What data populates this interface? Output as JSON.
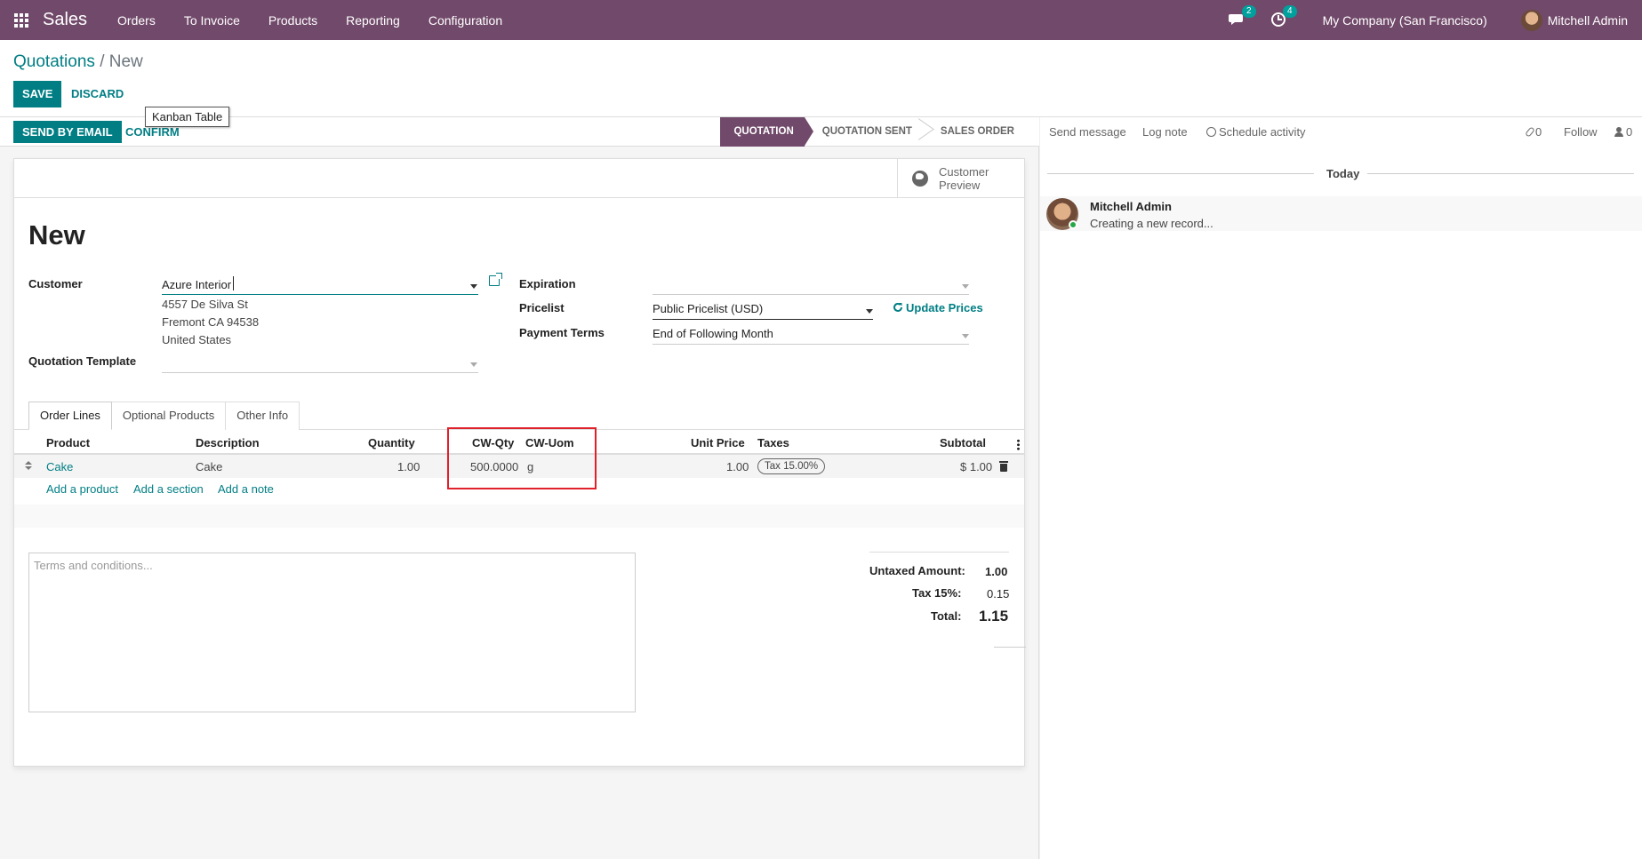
{
  "navbar": {
    "app_name": "Sales",
    "menu": [
      "Orders",
      "To Invoice",
      "Products",
      "Reporting",
      "Configuration"
    ],
    "messages_badge": "2",
    "activities_badge": "4",
    "company": "My Company (San Francisco)",
    "user": "Mitchell Admin"
  },
  "breadcrumb": {
    "parent": "Quotations",
    "separator": "/",
    "current": "New"
  },
  "control": {
    "save_label": "SAVE",
    "discard_label": "DISCARD",
    "tooltip": "Kanban Table"
  },
  "statusbar": {
    "send_email_label": "SEND BY EMAIL",
    "confirm_label": "CONFIRM",
    "stages": [
      "QUOTATION",
      "QUOTATION SENT",
      "SALES ORDER"
    ],
    "active_stage": "QUOTATION"
  },
  "sheet": {
    "customer_preview_line1": "Customer",
    "customer_preview_line2": "Preview",
    "title": "New",
    "customer_label": "Customer",
    "customer_value": "Azure Interior",
    "address_line1": "4557 De Silva St",
    "address_line2": "Fremont CA 94538",
    "address_line3": "United States",
    "template_label": "Quotation Template",
    "template_value": "",
    "expiration_label": "Expiration",
    "expiration_value": "",
    "pricelist_label": "Pricelist",
    "pricelist_value": "Public Pricelist (USD)",
    "update_prices_label": "Update Prices",
    "payment_terms_label": "Payment Terms",
    "payment_terms_value": "End of Following Month"
  },
  "tabs": [
    "Order Lines",
    "Optional Products",
    "Other Info"
  ],
  "order_lines": {
    "headers": {
      "product": "Product",
      "description": "Description",
      "quantity": "Quantity",
      "cw_qty": "CW-Qty",
      "cw_uom": "CW-Uom",
      "unit_price": "Unit Price",
      "taxes": "Taxes",
      "subtotal": "Subtotal"
    },
    "rows": [
      {
        "product": "Cake",
        "description": "Cake",
        "quantity": "1.00",
        "cw_qty": "500.0000",
        "cw_uom": "g",
        "unit_price": "1.00",
        "tax": "Tax 15.00%",
        "subtotal": "$ 1.00"
      }
    ],
    "add_product": "Add a product",
    "add_section": "Add a section",
    "add_note": "Add a note"
  },
  "terms_placeholder": "Terms and conditions...",
  "totals": {
    "untaxed_label": "Untaxed Amount:",
    "untaxed_value": "1.00",
    "tax_label": "Tax 15%:",
    "tax_value": "0.15",
    "total_label": "Total:",
    "total_value": "1.15"
  },
  "chatter": {
    "send_message": "Send message",
    "log_note": "Log note",
    "schedule_activity": "Schedule activity",
    "attachments_count": "0",
    "follow": "Follow",
    "followers_count": "0",
    "date_separator": "Today",
    "message_author": "Mitchell Admin",
    "message_body": "Creating a new record..."
  },
  "colors": {
    "brand": "#71496a",
    "primary": "#017e84",
    "highlight": "#e0202a"
  }
}
